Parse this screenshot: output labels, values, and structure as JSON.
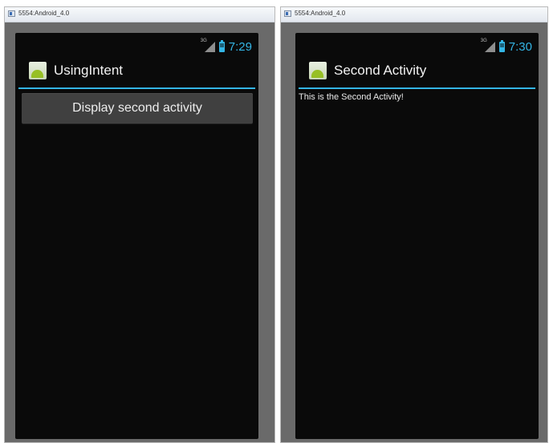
{
  "left_window": {
    "title": "5554:Android_4.0",
    "status": {
      "network_label": "3G",
      "time": "7:29"
    },
    "action_bar": {
      "title": "UsingIntent"
    },
    "button_label": "Display second activity"
  },
  "right_window": {
    "title": "5554:Android_4.0",
    "status": {
      "network_label": "3G",
      "time": "7:30"
    },
    "action_bar": {
      "title": "Second Activity"
    },
    "body_text": "This is the Second Activity!"
  },
  "colors": {
    "accent": "#33b5e5",
    "screen_background": "#0a0a0a",
    "bezel": "#6a6a6a",
    "button_background": "#404040"
  },
  "icons": {
    "window": "emulator-window-icon",
    "signal": "signal-icon",
    "battery": "battery-icon",
    "app": "android-app-icon"
  }
}
